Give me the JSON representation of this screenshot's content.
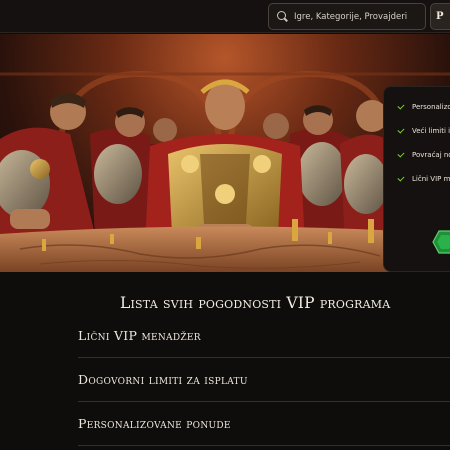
{
  "search": {
    "placeholder": "Igre, Kategorije, Provajderi"
  },
  "topbar": {
    "button_label": "P"
  },
  "vip_card": {
    "benefits": [
      "Personalizo",
      "Veći limiti i",
      "Povraćaj no",
      "Lični VIP m"
    ]
  },
  "section": {
    "title": "Lista svih pogodnosti VIP programa",
    "items": [
      "Lični VIP menadžer",
      "Dogovorni limiti za isplatu",
      "Personalizovane ponude"
    ]
  },
  "colors": {
    "background": "#0f0d0c",
    "accent_green": "#7fd23a",
    "gem_green": "#1f8f3a"
  },
  "icons": [
    "search-icon",
    "check-icon",
    "gem-icon"
  ]
}
